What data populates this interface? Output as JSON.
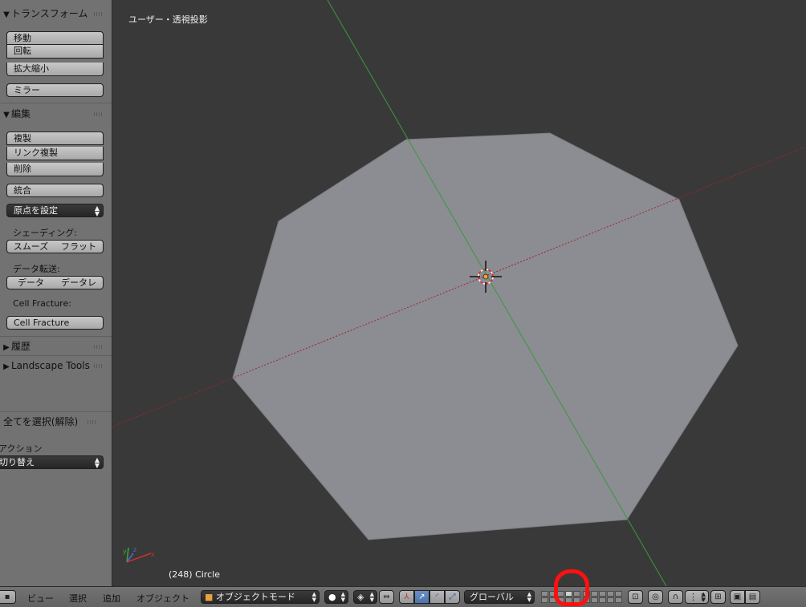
{
  "sidebar": {
    "transform": {
      "header": "トランスフォーム",
      "buttons": [
        "移動",
        "回転",
        "拡大縮小"
      ],
      "mirror": "ミラー"
    },
    "edit": {
      "header": "編集",
      "buttons": [
        "複製",
        "リンク複製",
        "削除"
      ],
      "join": "統合",
      "set_origin": "原点を設定",
      "shading_label": "シェーディング:",
      "shading_smooth": "スムーズ",
      "shading_flat": "フラット",
      "data_transfer_label": "データ転送:",
      "data_transfer_data": "データ",
      "data_transfer_datal": "データレ",
      "cell_fracture_label": "Cell Fracture:",
      "cell_fracture_button": "Cell Fracture"
    },
    "history": {
      "header": "履歴"
    },
    "landscape": {
      "header": "Landscape Tools"
    },
    "operator": {
      "header": "全てを選択(解除)",
      "action_label": "アクション",
      "action_value": "切り替え"
    }
  },
  "viewport": {
    "title": "ユーザー・透視投影",
    "object_info": "(248) Circle"
  },
  "header": {
    "menus": [
      "ビュー",
      "選択",
      "追加",
      "オブジェクト"
    ],
    "mode": "オブジェクトモード",
    "orientation": "グローバル"
  },
  "colors": {
    "mesh": "#8c8c93",
    "x_axis": "#9a2a2a",
    "y_axis": "#3a9a3a",
    "highlight": "#ff1010"
  }
}
